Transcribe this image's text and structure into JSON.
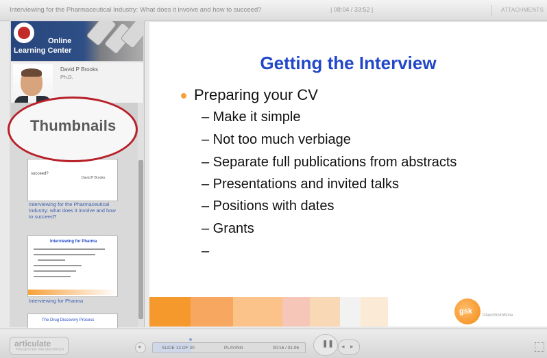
{
  "header": {
    "title": "Interviewing for the Pharmaceutical Industry: What does it involve and how to succeed?",
    "time": "| 08:04 / 33:52 |",
    "attachments": "ATTACHMENTS"
  },
  "sidebar": {
    "logo_line1": "Online",
    "logo_line2": "Learning Center",
    "presenter_name": "David P Brooks",
    "presenter_credentials": "Ph.D.",
    "thumbnails_label": "Thumbnails",
    "thumbnails": [
      {
        "caption": "Interviewing for the Pharmaceutical Industry: what does it involve and how to succeed?",
        "mini_title": "succeed?",
        "mini_author": "David P Brooks"
      },
      {
        "caption": "Interviewing for Pharma",
        "mini_title": "Interviewing for Pharma"
      },
      {
        "caption": "",
        "mini_title": "The Drug Discovery Process"
      }
    ]
  },
  "slide": {
    "title": "Getting the Interview",
    "bullet": "Preparing your CV",
    "sub_bullets": [
      "– Make it simple",
      "– Not too much verbiage",
      "– Separate full publications from abstracts",
      "– Presentations and invited talks",
      "– Positions with dates",
      "– Grants",
      "–"
    ],
    "logo_text": "gsk",
    "logo_name": "GlaxoSmithKline"
  },
  "player": {
    "brand": "articulate",
    "brand_sub": "PRESENTER PRESENTATION",
    "slide_count": "SLIDE 13 OF 30",
    "status": "PLAYING",
    "time": "00:16 / 01:06",
    "progress": 0.25
  },
  "colors": {
    "title_blue": "#2247c8",
    "bullet_orange": "#f5a23a",
    "highlight_red": "#b8202a",
    "link_blue": "#3d5fb0"
  }
}
